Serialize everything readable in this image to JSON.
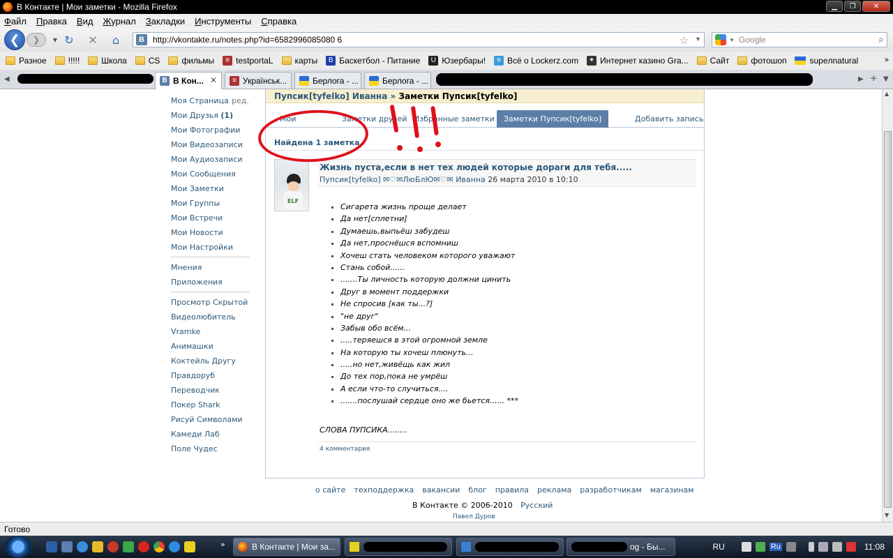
{
  "window": {
    "title": "В Контакте | Мои заметки - Mozilla Firefox",
    "minimize": "▁",
    "maximize": "❐",
    "close": "✕"
  },
  "menu": [
    "Файл",
    "Правка",
    "Вид",
    "Журнал",
    "Закладки",
    "Инструменты",
    "Справка"
  ],
  "nav": {
    "url": "http://vkontakte.ru/notes.php?id=6582996085080 6",
    "search_placeholder": "Google",
    "back_glyph": "❮",
    "forward_glyph": "❯"
  },
  "bookmarks": [
    {
      "label": "Разное",
      "icon": "folder-icon"
    },
    {
      "label": "!!!!!",
      "icon": "folder-icon"
    },
    {
      "label": "Школа",
      "icon": "folder-icon"
    },
    {
      "label": "CS",
      "icon": "folder-icon"
    },
    {
      "label": "фильмы",
      "icon": "folder-icon"
    },
    {
      "label": "testportaL",
      "icon": "book-icon"
    },
    {
      "label": "карты",
      "icon": "folder-icon"
    },
    {
      "label": "Баскетбол - Питание",
      "icon": "b-icon"
    },
    {
      "label": "Юзербары!",
      "icon": "ub-icon"
    },
    {
      "label": "Всё о Lockerz.com",
      "icon": "lockerz-icon"
    },
    {
      "label": "Интернет казино Gra...",
      "icon": "casino-icon"
    },
    {
      "label": "Сайт",
      "icon": "folder-icon"
    },
    {
      "label": "фотошоп",
      "icon": "folder-icon"
    },
    {
      "label": "supeлnatural",
      "icon": "flag-icon"
    }
  ],
  "tabs": [
    {
      "label": "В Кон...",
      "active": true
    },
    {
      "label": "Українськ...",
      "active": false
    },
    {
      "label": "Берлога - ...",
      "active": false
    },
    {
      "label": "Берлога - ...",
      "active": false
    }
  ],
  "sidebar": {
    "my_page": "Моя Страница",
    "edit": "ред.",
    "friends": "Мои Друзья",
    "friends_count": "(1)",
    "items_main": [
      "Мои Фотографии",
      "Мои Видеозаписи",
      "Мои Аудиозаписи",
      "Мои Сообщения",
      "Мои Заметки",
      "Мои Группы",
      "Мои Встречи",
      "Мои Новости",
      "Мои Настройки"
    ],
    "items_misc": [
      "Мнения",
      "Приложения"
    ],
    "items_apps": [
      "Просмотр Скрытой",
      "Видеолюбитель",
      "Vramke",
      "Анимашки",
      "Коктейль Другу",
      "Правдоруб",
      "Переводчик",
      "Покер Shark",
      "Рисуй Символами",
      "Камеди Лаб",
      "Поле Чудес"
    ]
  },
  "breadcrumb": {
    "parent": "Пупсик[tyfelko] Иванна",
    "separator": "»",
    "current": "Заметки Пупсик[tyfelko]"
  },
  "subtabs": {
    "my": "Мои",
    "friends": "Заметки друзей",
    "favorite": "Избранные заметки",
    "active": "Заметки Пупсик[tyfelko]",
    "add": "Добавить запись"
  },
  "found": "Найдена 1 заметка",
  "note": {
    "title": "Жизнь пуста,если в нет тех людей которые дораги для тебя.....",
    "author": "Пупсик[tyfelko] ✉♡✉ЛюБлЮ✉♡✉ Иванна",
    "date": "26 марта 2010 в 10:10",
    "lines": [
      "Сигарета жизнь проще делает",
      "Да нет[сплетни]",
      "Думаешь,выпьёш забудеш",
      "Да нет,проснёшся вспомниш",
      "Хочеш стать человеком которого уважают",
      "Стань собой......",
      ".......Ты личность которую должни цинить",
      "Друг в момент поддержки",
      "Не спросив [как ты...?]",
      "\"не друг\"",
      "Забыв обо всём...",
      ".....теряешся в этой огромной земле",
      "На которую ты хочеш плюнуть...",
      ".....но нет,живёщь как жил",
      "До тех пор,пока не умрёш",
      "А если что-то случиться....",
      ".......послушай сердце оно же бьется...... ***"
    ],
    "footer": "СЛОВА ПУПСИКА........",
    "comments": "4 комментария"
  },
  "footer": {
    "links": [
      "о сайте",
      "техподдержка",
      "вакансии",
      "блог",
      "правила",
      "реклама",
      "разработчикам",
      "магазинам"
    ],
    "copyright": "В Контакте © 2006-2010",
    "language": "Русский",
    "author": "Павел Дуров"
  },
  "status": "Готово",
  "taskbar": {
    "tasks": [
      {
        "label": "В Контакте | Мои за...",
        "active": true
      },
      {
        "label": "",
        "active": false
      },
      {
        "label": "",
        "active": false
      },
      {
        "label": "og - Бы...",
        "active": false
      }
    ],
    "lang": "RU",
    "kb": "Ru",
    "time": "11:08"
  },
  "colors": {
    "vk_link": "#2b587a",
    "annotation_red": "#e0101a",
    "breadcrumb_bg": "#f7efcf",
    "active_tab": "#5b7fa6"
  }
}
